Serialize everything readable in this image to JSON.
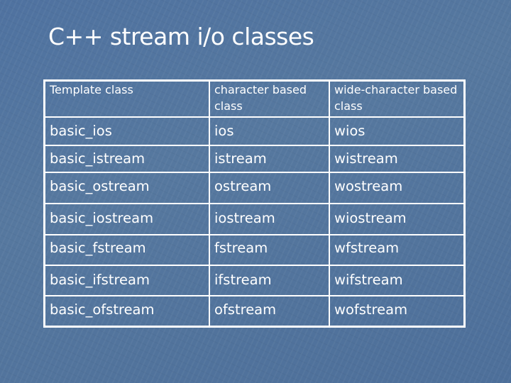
{
  "slide": {
    "title": "C++ stream i/o classes"
  },
  "table": {
    "headers": [
      "Template class",
      "character based class",
      "wide-character based class"
    ],
    "rows": [
      [
        "basic_ios",
        "ios",
        "wios"
      ],
      [
        "basic_istream",
        "istream",
        "wistream"
      ],
      [
        "basic_ostream",
        "ostream",
        "wostream"
      ],
      [
        "basic_iostream",
        "iostream",
        "wiostream"
      ],
      [
        "basic_fstream",
        "fstream",
        "wfstream"
      ],
      [
        "basic_ifstream",
        "ifstream",
        "wifstream"
      ],
      [
        "basic_ofstream",
        "ofstream",
        "wofstream"
      ]
    ]
  },
  "colors": {
    "background": "#52749f",
    "text": "#ffffff",
    "grid": "#ffffff"
  }
}
